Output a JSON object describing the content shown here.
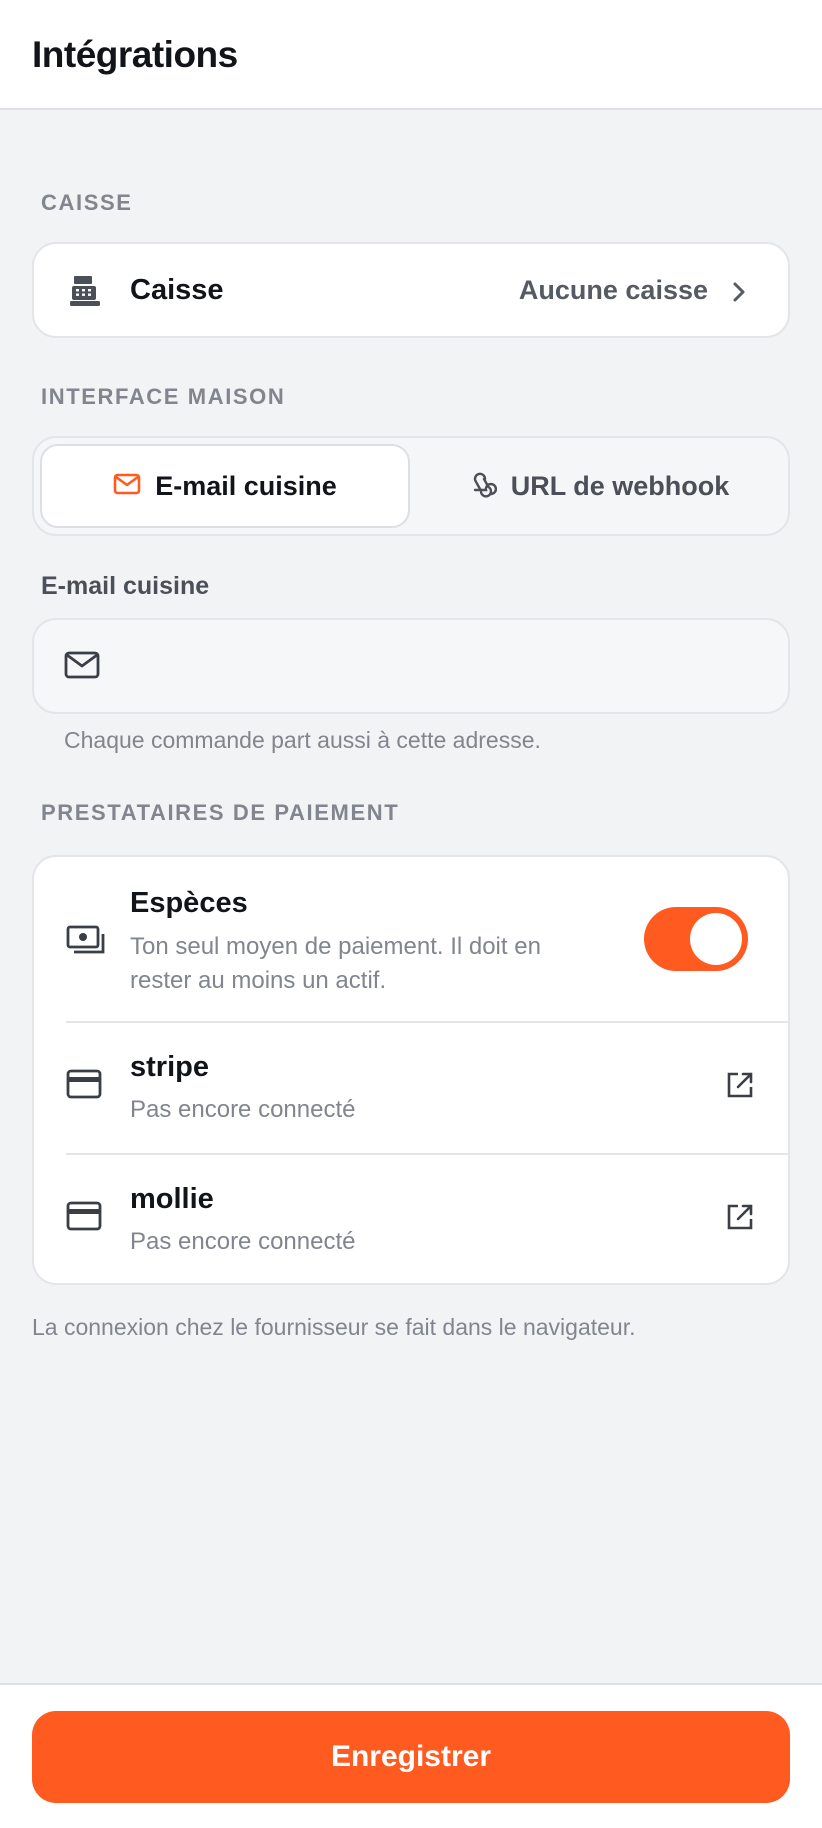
{
  "header": {
    "title": "Intégrations"
  },
  "pos_section": {
    "label": "CAISSE",
    "row": {
      "icon": "cash-register-icon",
      "title": "Caisse",
      "value": "Aucune caisse"
    }
  },
  "interface_section": {
    "label": "INTERFACE MAISON",
    "options": [
      {
        "icon": "mail-icon",
        "label": "E-mail cuisine",
        "selected": true
      },
      {
        "icon": "webhook-icon",
        "label": "URL de webhook",
        "selected": false
      }
    ],
    "email_field": {
      "label": "E-mail cuisine",
      "value": "",
      "placeholder": "",
      "helper": "Chaque commande part aussi à cette adresse."
    }
  },
  "payment_section": {
    "label": "PRESTATAIRES DE PAIEMENT",
    "providers": [
      {
        "icon": "cash-icon",
        "name": "Espèces",
        "description": "Ton seul moyen de paiement. Il doit en rester au moins un actif.",
        "enabled": true
      },
      {
        "icon": "credit-card-icon",
        "name": "stripe",
        "description": "Pas encore connecté",
        "action_icon": "external-link-icon"
      },
      {
        "icon": "credit-card-icon",
        "name": "mollie",
        "description": "Pas encore connecté",
        "action_icon": "external-link-icon"
      }
    ],
    "footnote": "La connexion chez le fournisseur se fait dans le navigateur."
  },
  "footer": {
    "save_label": "Enregistrer"
  },
  "colors": {
    "accent": "#ff5a1f",
    "background": "#f2f3f5",
    "muted_text": "#80858e"
  }
}
